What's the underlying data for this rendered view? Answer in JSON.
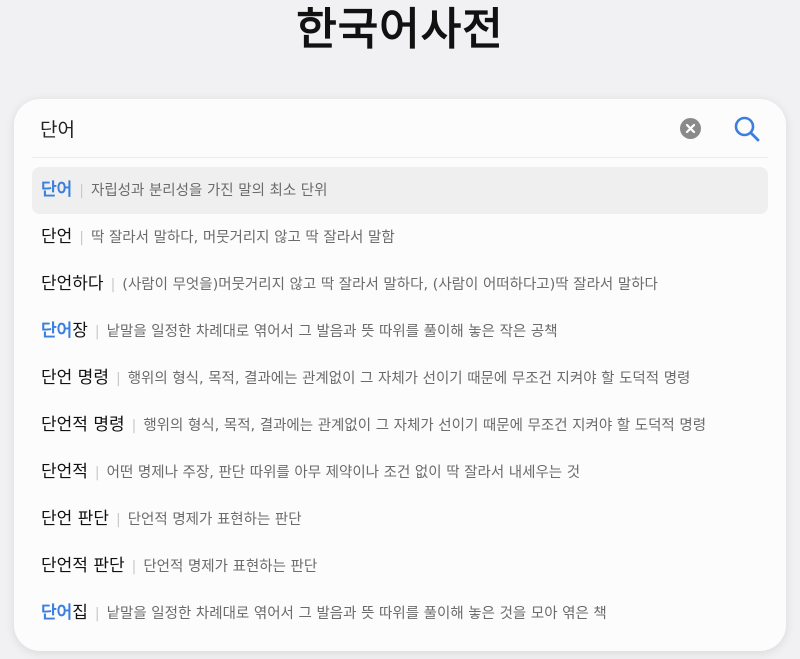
{
  "title": "한국어사전",
  "search": {
    "query": "단어"
  },
  "separator": "|",
  "colors": {
    "accent": "#3a7ee0",
    "clear_icon": "#8a8a8a",
    "text": "#111111",
    "definition": "#6b6b6b"
  },
  "icons": {
    "clear": "clear-icon",
    "search": "search-icon"
  },
  "results": [
    {
      "match": "단어",
      "rest": "",
      "definition": "자립성과 분리성을 가진 말의 최소 단위",
      "selected": true
    },
    {
      "match": "",
      "rest": "단언",
      "definition": "딱 잘라서 말하다, 머뭇거리지 않고 딱 잘라서 말함",
      "selected": false
    },
    {
      "match": "",
      "rest": "단언하다",
      "definition": "(사람이 무엇을)머뭇거리지 않고 딱 잘라서 말하다, (사람이 어떠하다고)딱 잘라서 말하다",
      "selected": false
    },
    {
      "match": "단어",
      "rest": "장",
      "definition": "낱말을 일정한 차례대로 엮어서 그 발음과 뜻 따위를 풀이해 놓은 작은 공책",
      "selected": false
    },
    {
      "match": "",
      "rest": "단언 명령",
      "definition": "행위의 형식, 목적, 결과에는 관계없이 그 자체가 선이기 때문에 무조건 지켜야 할 도덕적 명령",
      "selected": false
    },
    {
      "match": "",
      "rest": "단언적 명령",
      "definition": "행위의 형식, 목적, 결과에는 관계없이 그 자체가 선이기 때문에 무조건 지켜야 할 도덕적 명령",
      "selected": false
    },
    {
      "match": "",
      "rest": "단언적",
      "definition": "어떤 명제나 주장, 판단 따위를 아무 제약이나 조건 없이 딱 잘라서 내세우는 것",
      "selected": false
    },
    {
      "match": "",
      "rest": "단언 판단",
      "definition": "단언적 명제가 표현하는 판단",
      "selected": false
    },
    {
      "match": "",
      "rest": "단언적 판단",
      "definition": "단언적 명제가 표현하는 판단",
      "selected": false
    },
    {
      "match": "단어",
      "rest": "집",
      "definition": "낱말을 일정한 차례대로 엮어서 그 발음과 뜻 따위를 풀이해 놓은 것을 모아 엮은 책",
      "selected": false
    }
  ]
}
